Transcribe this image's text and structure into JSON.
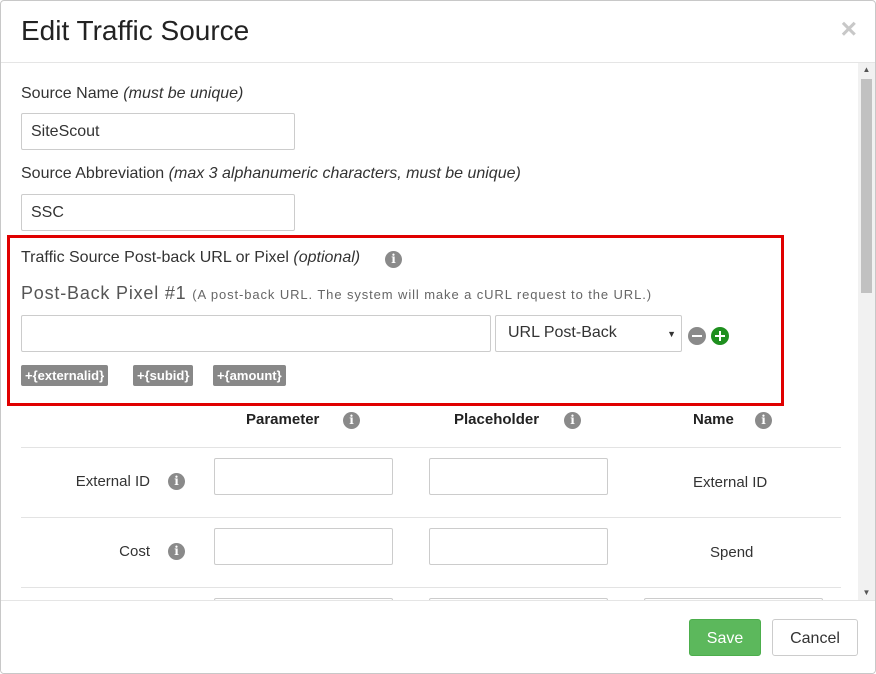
{
  "header": {
    "title": "Edit Traffic Source",
    "close_glyph": "×"
  },
  "form": {
    "source_name": {
      "label": "Source Name",
      "hint": "(must be unique)",
      "value": "SiteScout"
    },
    "source_abbr": {
      "label": "Source Abbreviation",
      "hint": "(max 3 alphanumeric characters, must be unique)",
      "value": "SSC"
    },
    "postback": {
      "label": "Traffic Source Post-back URL or Pixel",
      "hint": "(optional)",
      "pixel_title": "Post-Back Pixel #1",
      "pixel_desc": "(A post-back URL. The system will make a cURL request to the URL.)",
      "url_value": "",
      "type_selected": "URL Post-Back",
      "tokens": [
        "+{externalid}",
        "+{subid}",
        "+{amount}"
      ]
    },
    "table": {
      "headers": {
        "parameter": "Parameter",
        "placeholder": "Placeholder",
        "name": "Name"
      },
      "rows": [
        {
          "label": "External ID",
          "parameter": "",
          "placeholder": "",
          "name": "External ID"
        },
        {
          "label": "Cost",
          "parameter": "",
          "placeholder": "",
          "name": "Spend"
        }
      ]
    }
  },
  "icons": {
    "info": "info-icon",
    "remove": "minus-circle-icon",
    "add": "plus-circle-icon",
    "close": "close-icon"
  },
  "colors": {
    "highlight": "#e00000",
    "save": "#5cb85c",
    "add": "#1e8f1e"
  },
  "footer": {
    "save_label": "Save",
    "cancel_label": "Cancel"
  }
}
